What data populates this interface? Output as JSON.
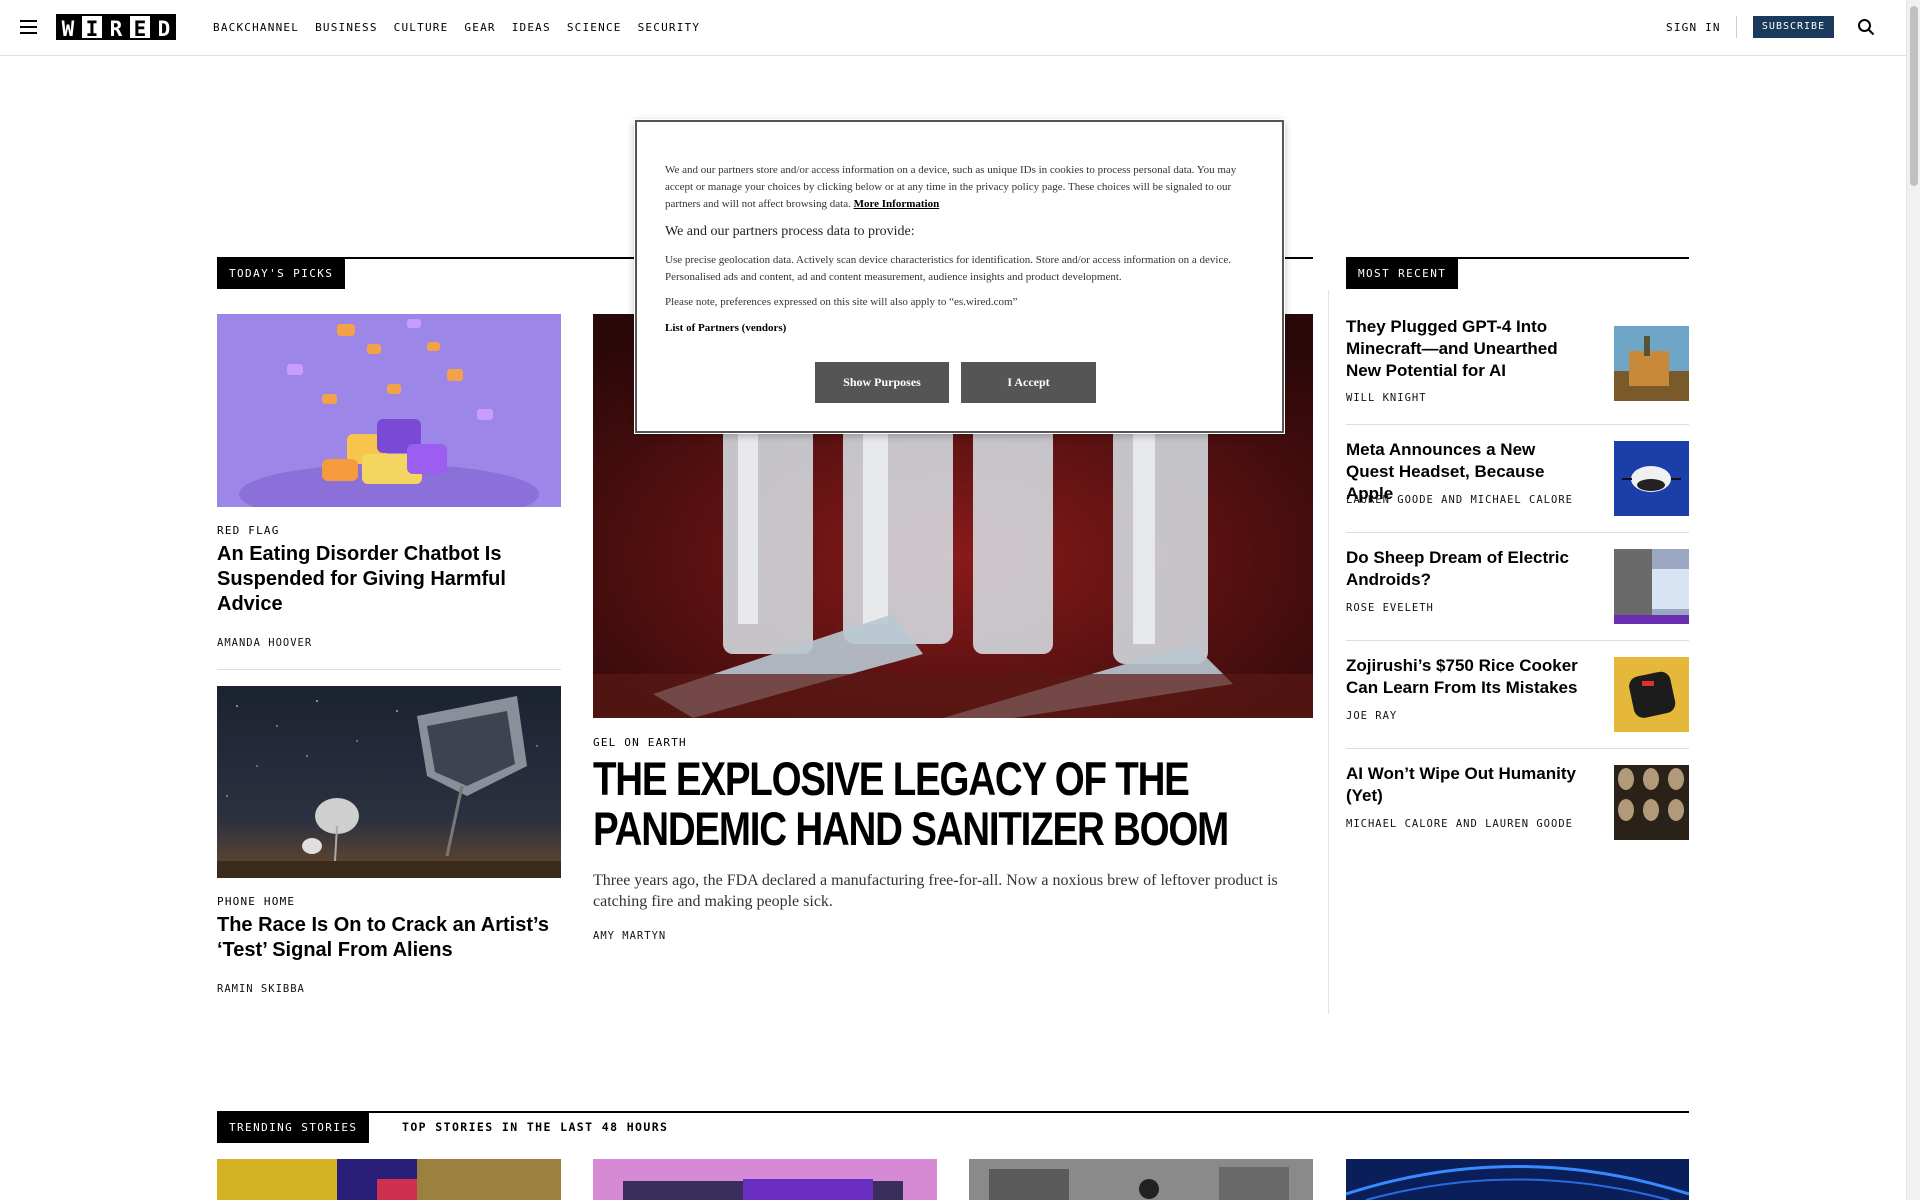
{
  "header": {
    "logo_letters": [
      "W",
      "I",
      "R",
      "E",
      "D"
    ],
    "nav": [
      "BACKCHANNEL",
      "BUSINESS",
      "CULTURE",
      "GEAR",
      "IDEAS",
      "SCIENCE",
      "SECURITY"
    ],
    "sign_in": "SIGN IN",
    "subscribe": "SUBSCRIBE"
  },
  "todays_picks": {
    "label": "TODAY'S PICKS",
    "cards": [
      {
        "rubric": "RED FLAG",
        "headline": "An Eating Disorder Chatbot Is Suspended for Giving Harmful Advice",
        "byline": "AMANDA HOOVER"
      },
      {
        "rubric": "PHONE HOME",
        "headline": "The Race Is On to Crack an Artist’s ‘Test’ Signal From Aliens",
        "byline": "RAMIN SKIBBA"
      }
    ],
    "feature": {
      "rubric": "GEL ON EARTH",
      "headline": "THE EXPLOSIVE LEGACY OF THE PANDEMIC HAND SANITIZER BOOM",
      "dek": "Three years ago, the FDA declared a manufacturing free-for-all. Now a noxious brew of leftover product is catching fire and making people sick.",
      "byline": "AMY MARTYN"
    }
  },
  "most_recent": {
    "label": "MOST RECENT",
    "items": [
      {
        "headline": "They Plugged GPT-4 Into Minecraft—and Unearthed New Potential for AI",
        "byline": "WILL KNIGHT"
      },
      {
        "headline": "Meta Announces a New Quest Headset, Because Apple",
        "byline": "LAUREN GOODE AND MICHAEL CALORE"
      },
      {
        "headline": "Do Sheep Dream of Electric Androids?",
        "byline": "ROSE EVELETH"
      },
      {
        "headline": "Zojirushi’s $750 Rice Cooker Can Learn From Its Mistakes",
        "byline": "JOE RAY"
      },
      {
        "headline": "AI Won’t Wipe Out Humanity (Yet)",
        "byline": "MICHAEL CALORE AND LAUREN GOODE"
      }
    ]
  },
  "trending": {
    "label": "TRENDING STORIES",
    "tab": "TOP STORIES IN THE LAST 48 HOURS"
  },
  "consent": {
    "intro": "We and our partners store and/or access information on a device, such as unique IDs in cookies to process personal data. You may accept or manage your choices by clicking below or at any time in the privacy policy page. These choices will be signaled to our partners and will not affect browsing data.",
    "more_info": "More Information",
    "heading": "We and our partners process data to provide:",
    "purposes": "Use precise geolocation data. Actively scan device characteristics for identification. Store and/or access information on a device. Personalised ads and content, ad and content measurement, audience insights and product development.",
    "note": "Please note, preferences expressed on this site will also apply to “es.wired.com”",
    "partners_link": "List of Partners (vendors)",
    "show_purposes": "Show Purposes",
    "accept": "I Accept"
  }
}
